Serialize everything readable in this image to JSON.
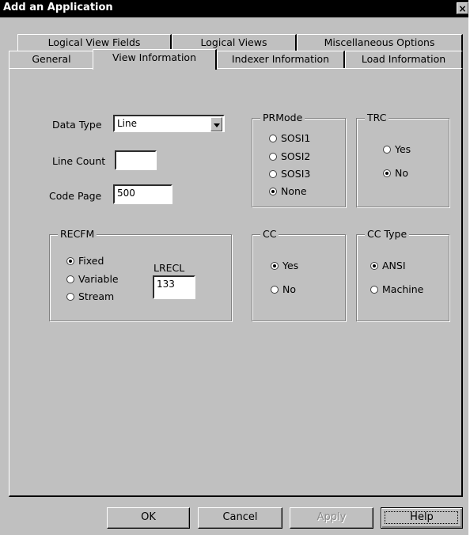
{
  "window": {
    "title": "Add an Application",
    "close_label": "×"
  },
  "tabs": {
    "row1": [
      "Logical View Fields",
      "Logical Views",
      "Miscellaneous Options"
    ],
    "row2": [
      "General",
      "View Information",
      "Indexer Information",
      "Load Information"
    ],
    "active": "View Information"
  },
  "form": {
    "data_type": {
      "label": "Data Type",
      "value": "Line"
    },
    "line_count": {
      "label": "Line Count",
      "value": ""
    },
    "code_page": {
      "label": "Code Page",
      "value": "500"
    }
  },
  "prmode": {
    "title": "PRMode",
    "options": [
      "SOSI1",
      "SOSI2",
      "SOSI3",
      "None"
    ],
    "selected": "None"
  },
  "trc": {
    "title": "TRC",
    "options": [
      "Yes",
      "No"
    ],
    "selected": "No"
  },
  "recfm": {
    "title": "RECFM",
    "options": [
      "Fixed",
      "Variable",
      "Stream"
    ],
    "selected": "Fixed",
    "lrecl_label": "LRECL",
    "lrecl_value": "133"
  },
  "cc": {
    "title": "CC",
    "options": [
      "Yes",
      "No"
    ],
    "selected": "Yes"
  },
  "cc_type": {
    "title": "CC Type",
    "options": [
      "ANSI",
      "Machine"
    ],
    "selected": "ANSI"
  },
  "buttons": {
    "ok": "OK",
    "cancel": "Cancel",
    "apply": "Apply",
    "help": "Help"
  }
}
